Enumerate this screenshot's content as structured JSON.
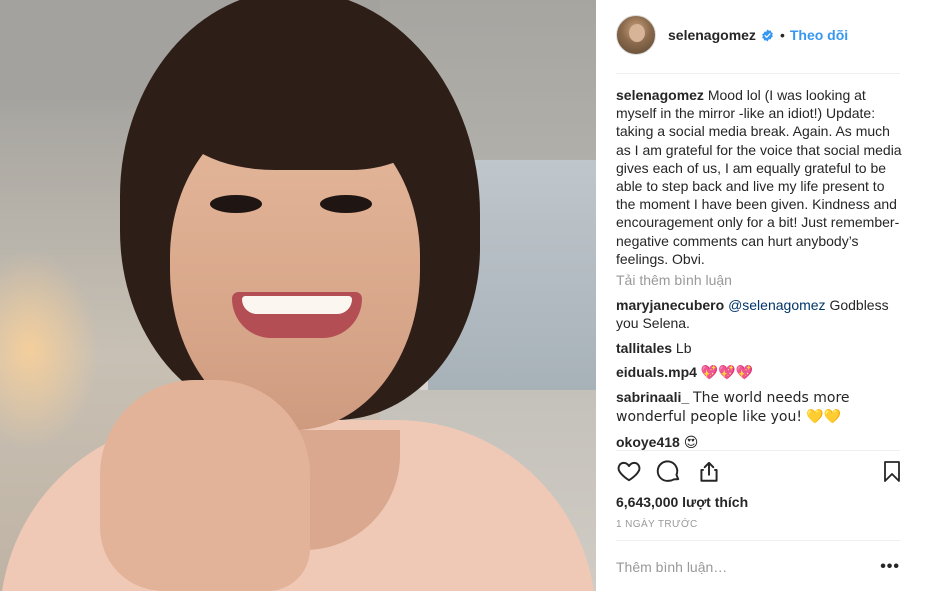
{
  "post": {
    "username": "selenagomez",
    "verified": true,
    "follow_label": "Theo dõi",
    "separator": "•",
    "caption": "Mood lol (I was looking at myself in the mirror -like an idiot!) Update: taking a social media break. Again. As much as I am grateful for the voice that social media gives each of us, I am equally grateful to be able to step back and live my life present to the moment I have been given. Kindness and encouragement only for a bit! Just remember- negative comments can hurt anybody’s feelings. Obvi.",
    "load_more_label": "Tải thêm bình luận",
    "comments": [
      {
        "user": "maryjanecubero",
        "mention": "@selenagomez",
        "text": " Godbless you Selena."
      },
      {
        "user": "tallitales",
        "mention": "",
        "text": "Lb"
      },
      {
        "user": "eiduals.mp4",
        "mention": "",
        "text": "💖💖💖"
      },
      {
        "user": "sabrinaali_",
        "mention": "",
        "text": "The world needs more wonderful people like you! 💛💛"
      },
      {
        "user": "okoye418",
        "mention": "",
        "text": "😍"
      }
    ],
    "likes_label": "6,643,000 lượt thích",
    "timestamp": "1 NGÀY TRƯỚC",
    "add_comment_placeholder": "Thêm bình luận…",
    "more_label": "•••",
    "icons": {
      "like": "heart-icon",
      "comment": "comment-bubble-icon",
      "share": "share-icon",
      "save": "bookmark-icon",
      "verified": "verified-badge-icon"
    },
    "colors": {
      "link": "#3897f0",
      "verified": "#3897f0",
      "muted": "#999999",
      "text": "#262626"
    }
  }
}
